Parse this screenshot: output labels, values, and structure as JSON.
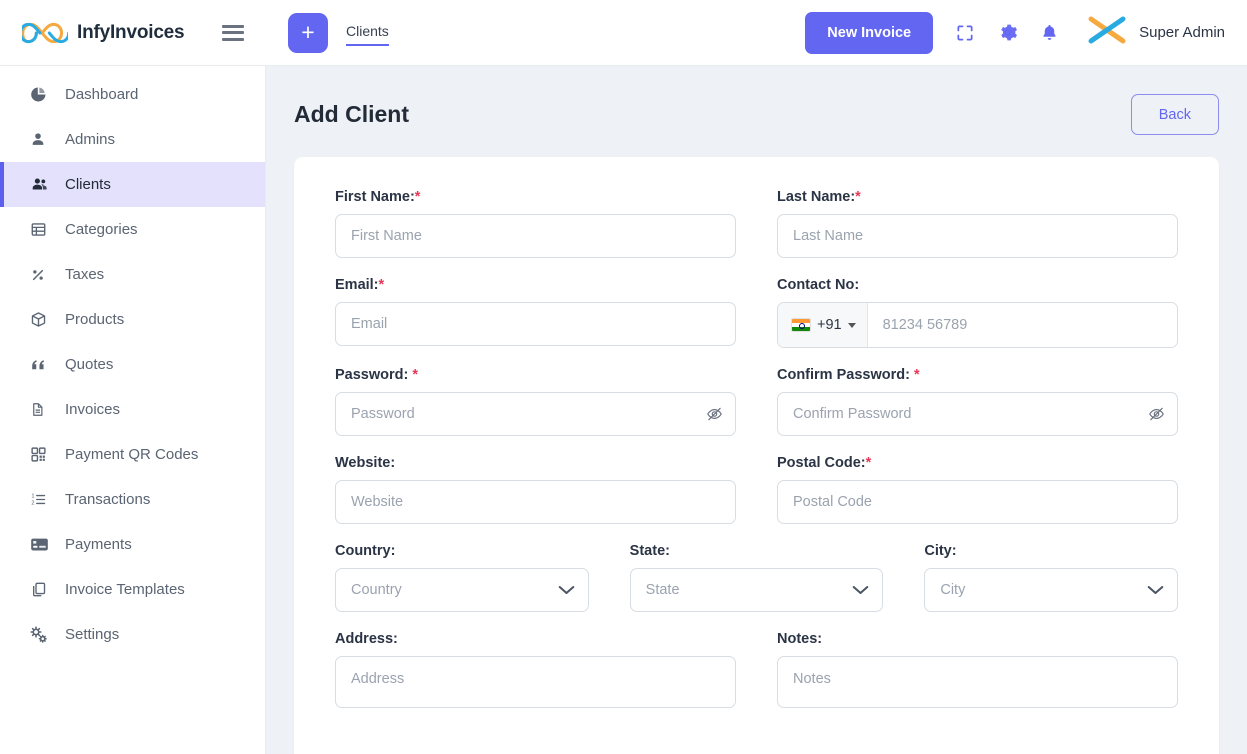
{
  "app": {
    "brand_name": "InfyInvoices",
    "logo_icon": "infinity-logo-icon",
    "menu_toggle_icon": "hamburger-menu-icon"
  },
  "topbar": {
    "add_button_label": "+",
    "active_tab": "Clients",
    "new_invoice_label": "New Invoice",
    "fullscreen_icon": "fullscreen-expand-icon",
    "settings_icon": "gear-icon",
    "notifications_icon": "bell-icon",
    "avatar_icon": "x-cross-avatar-icon",
    "user_name": "Super Admin",
    "accent_color": "#6366f1"
  },
  "sidebar": {
    "items": [
      {
        "label": "Dashboard",
        "icon": "pie-chart-icon",
        "active": false
      },
      {
        "label": "Admins",
        "icon": "user-icon",
        "active": false
      },
      {
        "label": "Clients",
        "icon": "users-group-icon",
        "active": true
      },
      {
        "label": "Categories",
        "icon": "table-list-icon",
        "active": false
      },
      {
        "label": "Taxes",
        "icon": "percent-icon",
        "active": false
      },
      {
        "label": "Products",
        "icon": "box-cube-icon",
        "active": false
      },
      {
        "label": "Quotes",
        "icon": "quote-marks-icon",
        "active": false
      },
      {
        "label": "Invoices",
        "icon": "document-icon",
        "active": false
      },
      {
        "label": "Payment QR Codes",
        "icon": "qr-code-icon",
        "active": false
      },
      {
        "label": "Transactions",
        "icon": "ordered-list-icon",
        "active": false
      },
      {
        "label": "Payments",
        "icon": "credit-card-icon",
        "active": false
      },
      {
        "label": "Invoice Templates",
        "icon": "copy-documents-icon",
        "active": false
      },
      {
        "label": "Settings",
        "icon": "gears-icon",
        "active": false
      }
    ],
    "active_bg_color": "#e3e1fb",
    "active_accent_color": "#5d5fef"
  },
  "page": {
    "title": "Add Client",
    "back_button_label": "Back"
  },
  "form": {
    "first_name": {
      "label": "First Name:",
      "required": "*",
      "placeholder": "First Name",
      "value": ""
    },
    "last_name": {
      "label": "Last Name:",
      "required": "*",
      "placeholder": "Last Name",
      "value": ""
    },
    "email": {
      "label": "Email:",
      "required": "*",
      "placeholder": "Email",
      "value": ""
    },
    "contact_no": {
      "label": "Contact No:",
      "country_code": "+91",
      "country_flag": "india-flag-icon",
      "placeholder": "81234 56789",
      "value": ""
    },
    "password": {
      "label": "Password:",
      "required": "*",
      "placeholder": "Password",
      "value": "",
      "toggle_icon": "eye-slash-icon"
    },
    "confirm_password": {
      "label": "Confirm Password:",
      "required": "*",
      "placeholder": "Confirm Password",
      "value": "",
      "toggle_icon": "eye-slash-icon"
    },
    "website": {
      "label": "Website:",
      "required": "",
      "placeholder": "Website",
      "value": ""
    },
    "postal_code": {
      "label": "Postal Code:",
      "required": "*",
      "placeholder": "Postal Code",
      "value": ""
    },
    "country": {
      "label": "Country:",
      "selected": "Country",
      "chevron_icon": "chevron-down-icon"
    },
    "state": {
      "label": "State:",
      "selected": "State",
      "chevron_icon": "chevron-down-icon"
    },
    "city": {
      "label": "City:",
      "selected": "City",
      "chevron_icon": "chevron-down-icon"
    },
    "address": {
      "label": "Address:",
      "placeholder": "Address",
      "value": ""
    },
    "notes": {
      "label": "Notes:",
      "placeholder": "Notes",
      "value": ""
    }
  }
}
